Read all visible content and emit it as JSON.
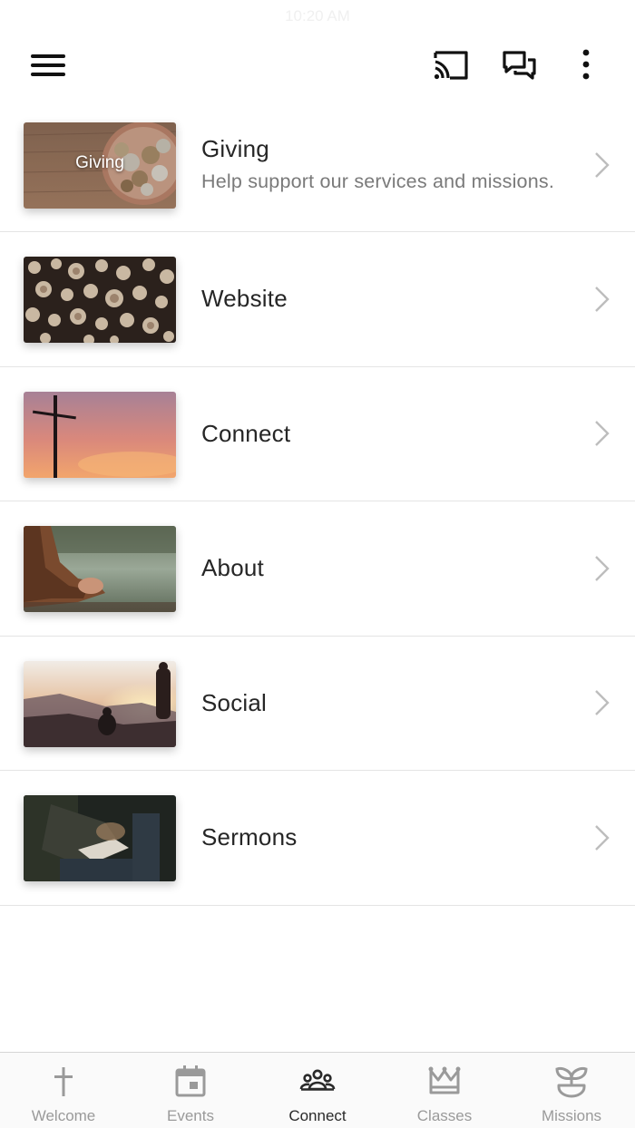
{
  "status": {
    "time": "10:20 AM"
  },
  "header": {
    "menu_icon": "hamburger-icon",
    "actions": [
      "cast-icon",
      "chat-icon",
      "more-vertical-icon"
    ]
  },
  "items": [
    {
      "title": "Giving",
      "subtitle": "Help support our services and missions.",
      "thumb_caption": "Giving",
      "thumb_scene": "coins-on-wood"
    },
    {
      "title": "Website",
      "subtitle": "",
      "thumb_caption": "",
      "thumb_scene": "stacked-logs"
    },
    {
      "title": "Connect",
      "subtitle": "",
      "thumb_caption": "",
      "thumb_scene": "cross-sunset"
    },
    {
      "title": "About",
      "subtitle": "",
      "thumb_caption": "",
      "thumb_scene": "praying-hands-lake"
    },
    {
      "title": "Social",
      "subtitle": "",
      "thumb_caption": "",
      "thumb_scene": "people-sunset-hill"
    },
    {
      "title": "Sermons",
      "subtitle": "",
      "thumb_caption": "",
      "thumb_scene": "reading-bibles"
    }
  ],
  "tabs": [
    {
      "label": "Welcome",
      "icon": "cross-icon",
      "active": false
    },
    {
      "label": "Events",
      "icon": "calendar-icon",
      "active": false
    },
    {
      "label": "Connect",
      "icon": "group-icon",
      "active": true
    },
    {
      "label": "Classes",
      "icon": "crown-icon",
      "active": false
    },
    {
      "label": "Missions",
      "icon": "sprout-icon",
      "active": false
    }
  ],
  "colors": {
    "accent_active": "#2a2a2a",
    "inactive": "#9a9a9a",
    "divider": "#e4e4e4"
  }
}
